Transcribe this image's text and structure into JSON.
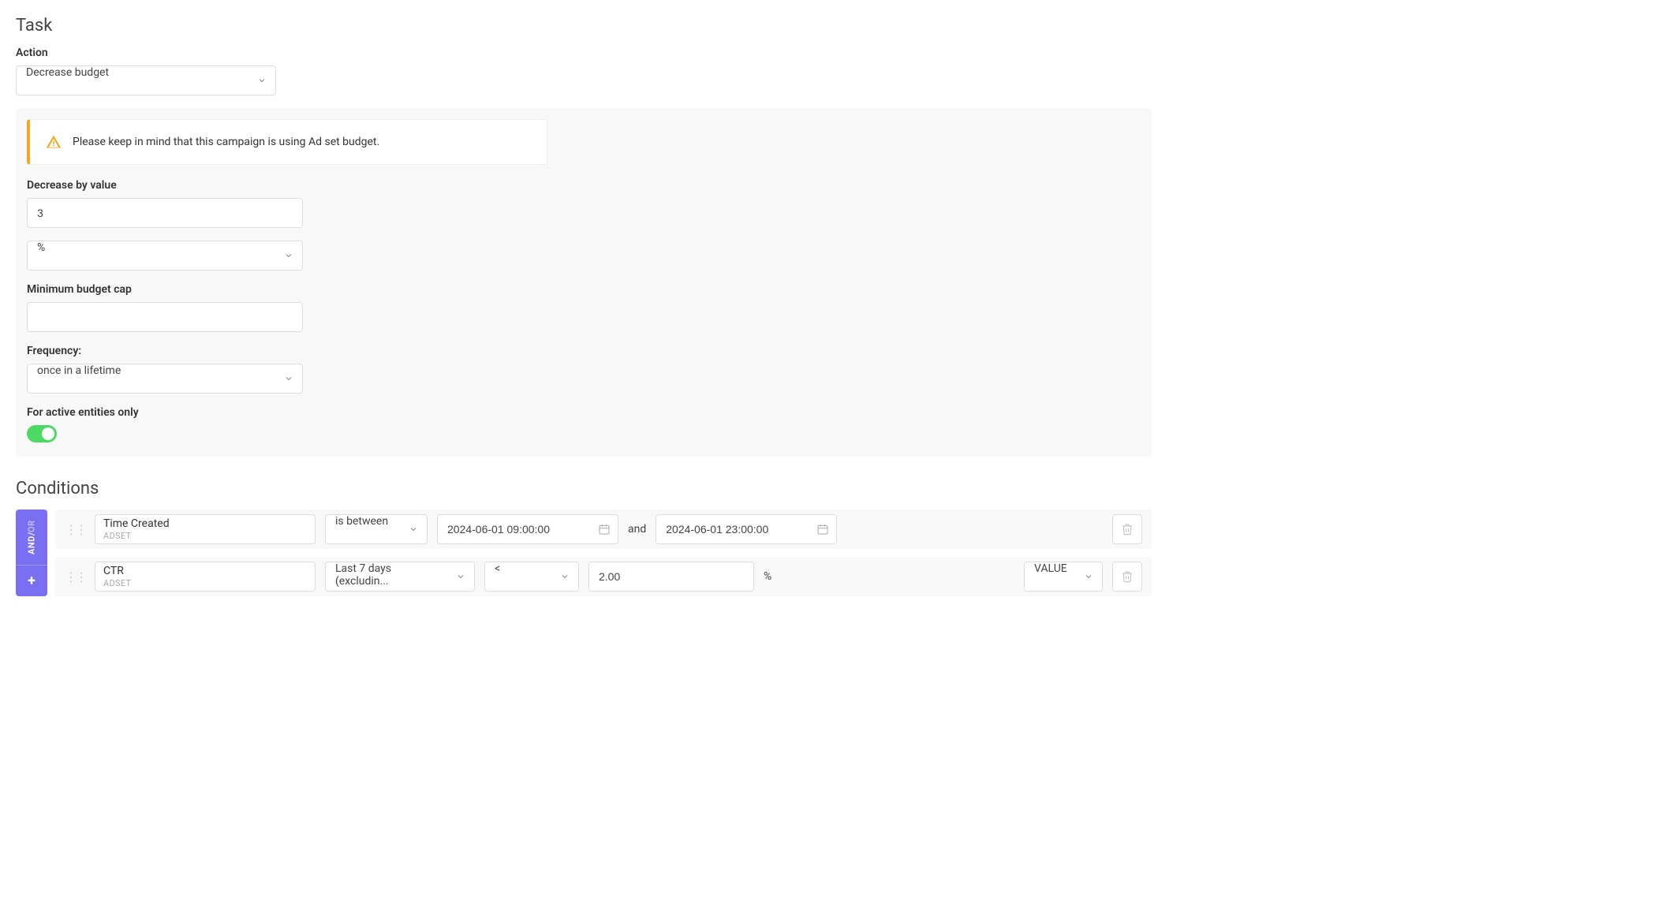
{
  "task": {
    "title": "Task",
    "action_label": "Action",
    "action_value": "Decrease budget",
    "alert": "Please keep in mind that this campaign is using Ad set budget.",
    "decrease_label": "Decrease by value",
    "decrease_value": "3",
    "unit_value": "%",
    "mincap_label": "Minimum budget cap",
    "mincap_value": "",
    "frequency_label": "Frequency:",
    "frequency_value": "once in a lifetime",
    "active_only_label": "For active entities only",
    "active_only": true
  },
  "conditions": {
    "title": "Conditions",
    "logic_and": "AND",
    "logic_sep": " / ",
    "logic_or": "OR",
    "add": "+",
    "rows": [
      {
        "metric": "Time Created",
        "scope": "ADSET",
        "operator": "is between",
        "from": "2024-06-01 09:00:00",
        "join": "and",
        "to": "2024-06-01 23:00:00"
      },
      {
        "metric": "CTR",
        "scope": "ADSET",
        "timeframe": "Last 7 days (excludin...",
        "operator": "<",
        "value": "2.00",
        "unit": "%",
        "compare": "VALUE"
      }
    ]
  }
}
